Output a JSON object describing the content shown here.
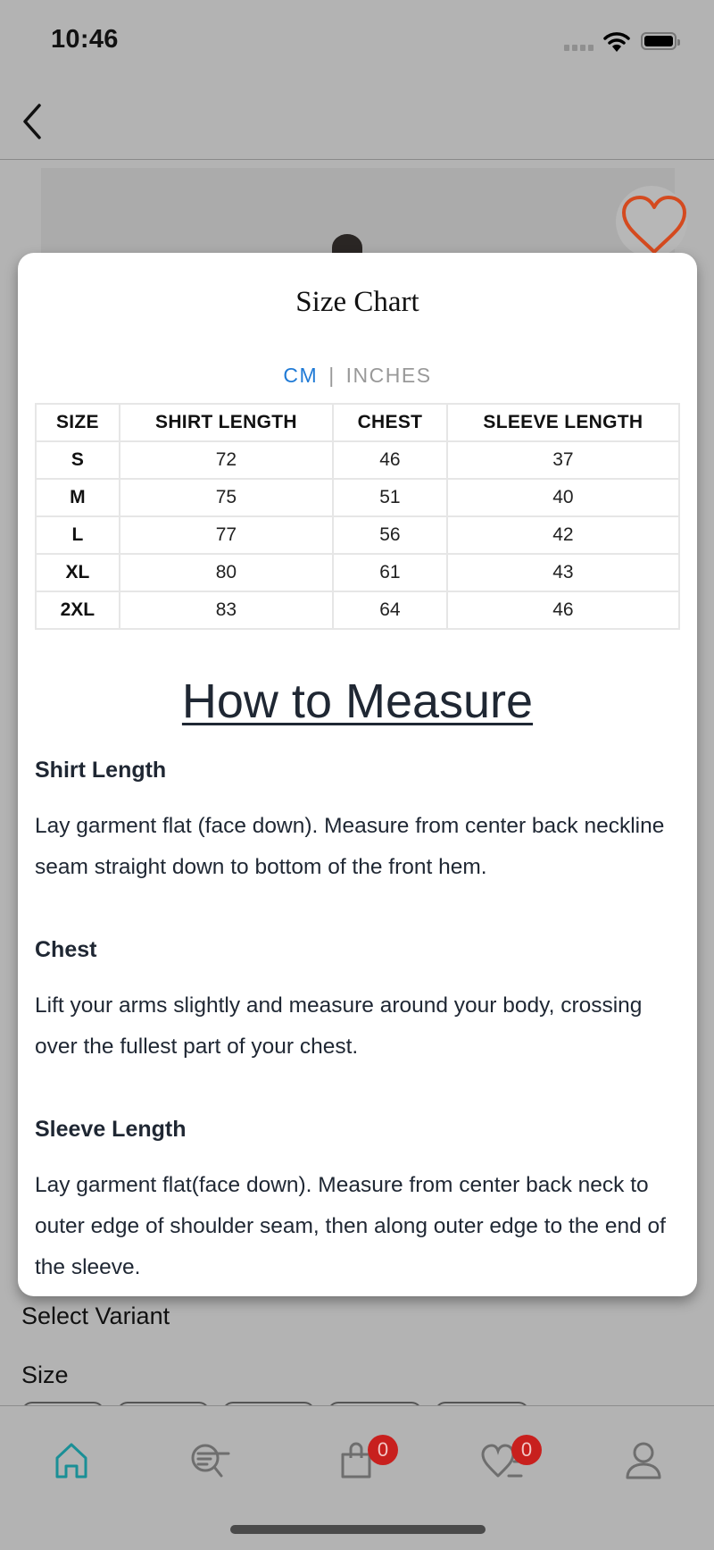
{
  "status_bar": {
    "time": "10:46"
  },
  "header": {
    "back_icon": "chevron-left-icon"
  },
  "product": {
    "favorite_icon": "heart-outline-icon",
    "accent_color": "#d44a1f"
  },
  "background_page": {
    "select_variant_label": "Select Variant",
    "size_label": "Size",
    "size_option_count": 5
  },
  "modal": {
    "title": "Size Chart",
    "units": {
      "active": "CM",
      "separator": "|",
      "inactive": "INCHES",
      "active_color": "#1f7ad6"
    },
    "table": {
      "headers": [
        "SIZE",
        "SHIRT LENGTH",
        "CHEST",
        "SLEEVE LENGTH"
      ],
      "rows": [
        [
          "S",
          "72",
          "46",
          "37"
        ],
        [
          "M",
          "75",
          "51",
          "40"
        ],
        [
          "L",
          "77",
          "56",
          "42"
        ],
        [
          "XL",
          "80",
          "61",
          "43"
        ],
        [
          "2XL",
          "83",
          "64",
          "46"
        ]
      ]
    },
    "how_to_measure": {
      "title": "How to Measure",
      "sections": [
        {
          "heading": "Shirt Length",
          "text": "Lay garment flat (face down). Measure from center back neckline seam straight down to bottom of the front hem."
        },
        {
          "heading": "Chest",
          "text": "Lift your arms slightly and measure around your body, crossing over the fullest part of your chest."
        },
        {
          "heading": "Sleeve Length",
          "text": "Lay garment flat(face down). Measure from center back neck to outer edge of shoulder seam, then along outer edge to the end of the sleeve."
        }
      ]
    }
  },
  "tab_bar": {
    "active_color": "#1a8f96",
    "tabs": [
      {
        "name": "home",
        "icon": "home-icon",
        "active": true
      },
      {
        "name": "search",
        "icon": "search-list-icon",
        "active": false
      },
      {
        "name": "cart",
        "icon": "shopping-bag-icon",
        "badge": "0",
        "active": false
      },
      {
        "name": "wishlist",
        "icon": "heart-list-icon",
        "badge": "0",
        "active": false
      },
      {
        "name": "profile",
        "icon": "user-icon",
        "active": false
      }
    ]
  }
}
